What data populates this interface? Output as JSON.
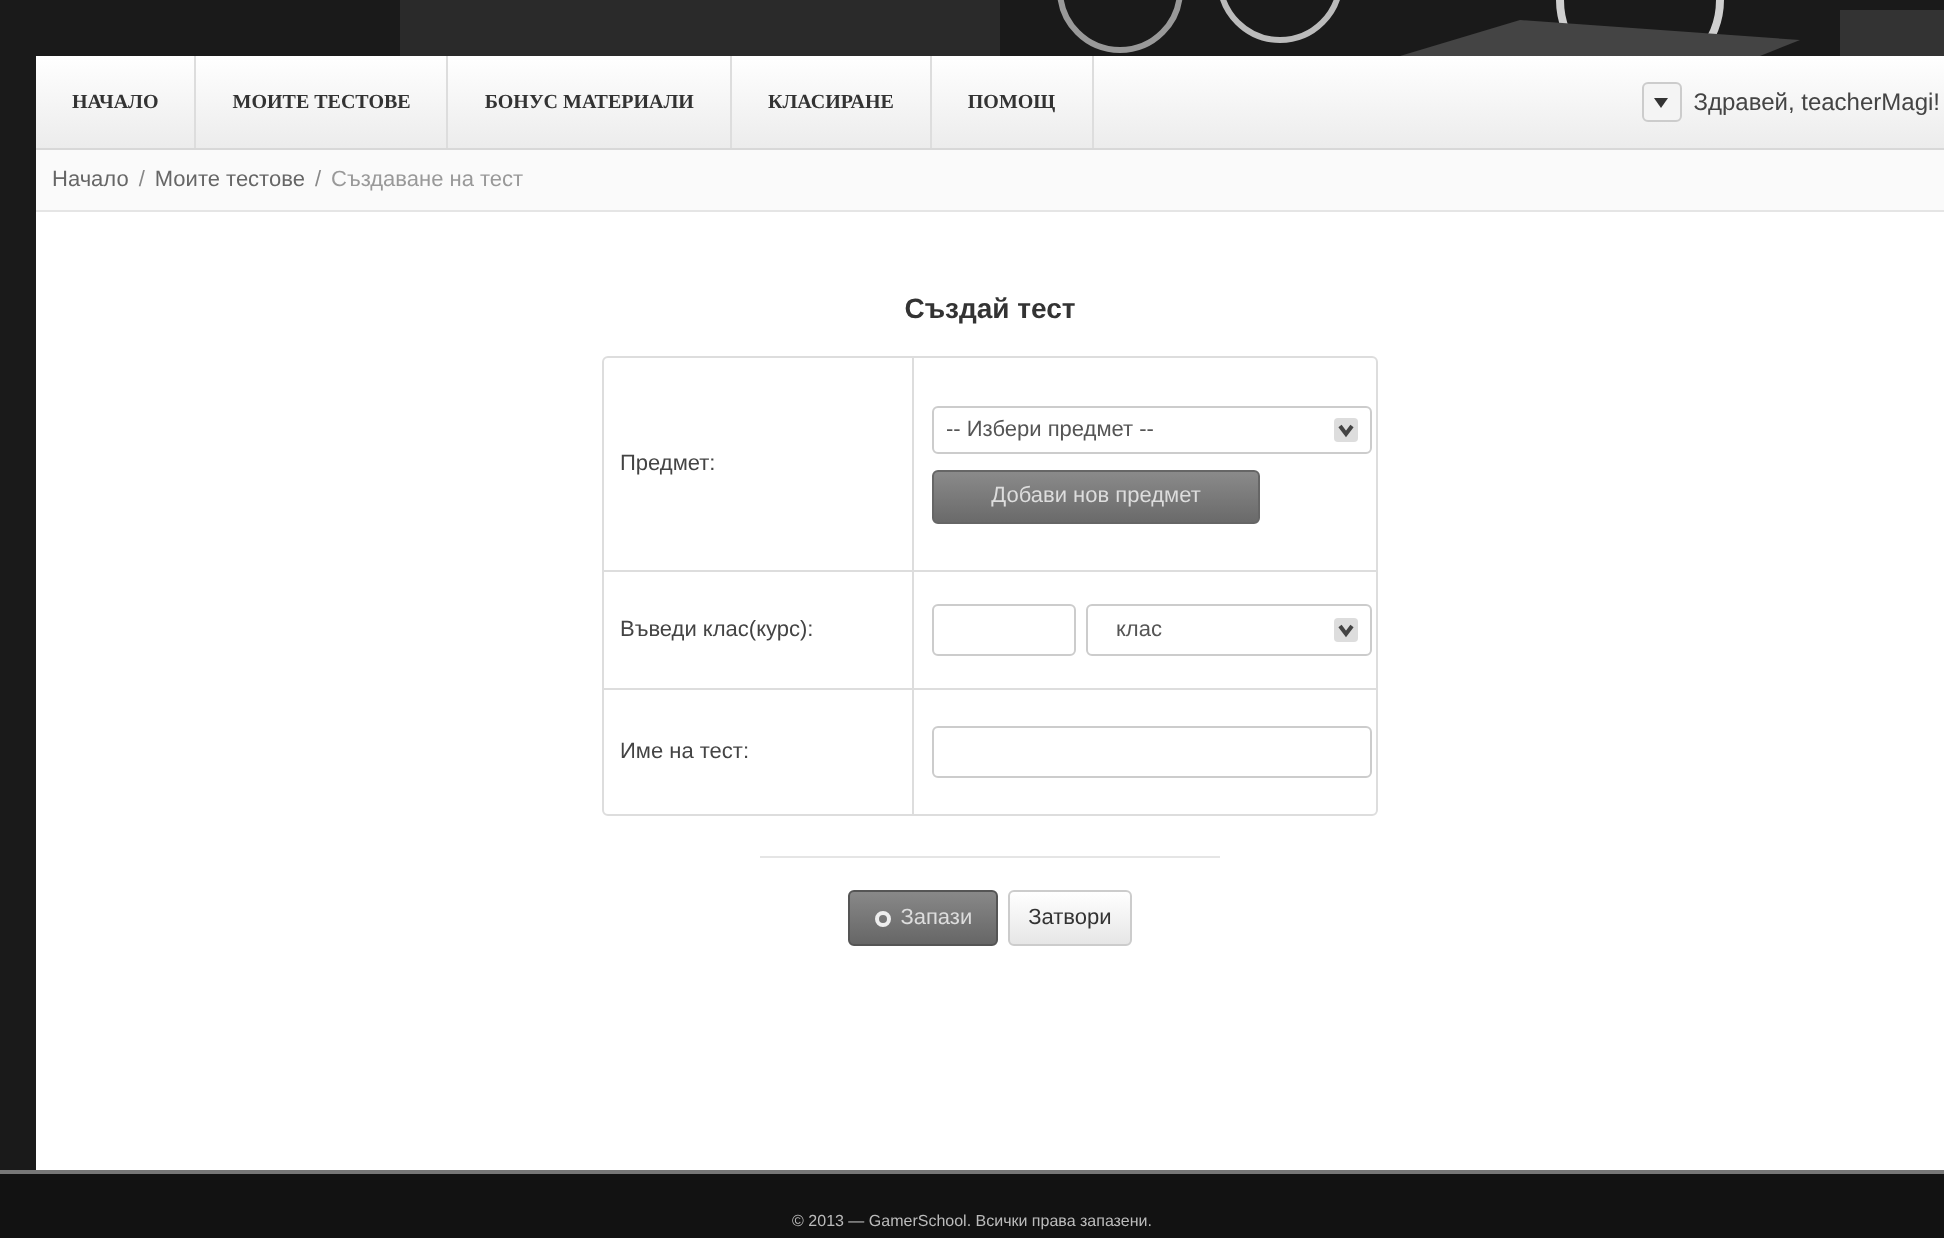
{
  "nav": {
    "items": [
      {
        "label": "НАЧАЛО"
      },
      {
        "label": "МОИТЕ ТЕСТОВЕ"
      },
      {
        "label": "БОНУС МАТЕРИАЛИ"
      },
      {
        "label": "КЛАСИРАНЕ"
      },
      {
        "label": "ПОМОЩ"
      }
    ],
    "greeting": "Здравей, teacherMagi!"
  },
  "breadcrumb": {
    "items": [
      {
        "label": "Начало"
      },
      {
        "label": "Моите тестове"
      },
      {
        "label": "Създаване на тест"
      }
    ],
    "separator": "/"
  },
  "form": {
    "title": "Създай тест",
    "rows": [
      {
        "kind": "subject",
        "label": "Предмет:",
        "select": "-- Избери предмет --",
        "button": "Добави нов предмет"
      },
      {
        "kind": "grade",
        "label": "Въведи клас(курс):",
        "select": "клас"
      },
      {
        "kind": "name",
        "label": "Име на тест:"
      }
    ],
    "buttons": [
      {
        "label": "Запази",
        "kind": "primary"
      },
      {
        "label": "Затвори",
        "kind": "default"
      }
    ]
  },
  "footer": "© 2013 — GamerSchool. Всички права запазени."
}
